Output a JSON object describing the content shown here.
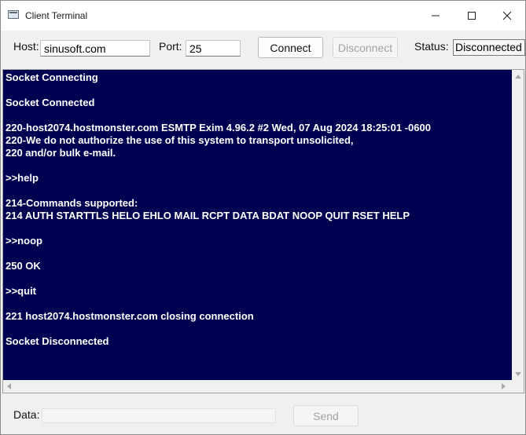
{
  "window": {
    "title": "Client Terminal",
    "icons": {
      "app": "app-window-icon",
      "minimize": "minimize-icon",
      "maximize": "maximize-icon",
      "close": "close-icon"
    }
  },
  "toolbar": {
    "host_label": "Host:",
    "host_value": "sinusoft.com",
    "port_label": "Port:",
    "port_value": "25",
    "connect_label": "Connect",
    "disconnect_label": "Disconnect",
    "status_label": "Status:",
    "status_value": "Disconnected"
  },
  "terminal": {
    "background": "#000050",
    "text_color": "#ffffff",
    "lines": [
      "Socket Connecting",
      "",
      "Socket Connected",
      "",
      "220-host2074.hostmonster.com ESMTP Exim 4.96.2 #2 Wed, 07 Aug 2024 18:25:01 -0600",
      "220-We do not authorize the use of this system to transport unsolicited,",
      "220 and/or bulk e-mail.",
      "",
      ">>help",
      "",
      "214-Commands supported:",
      "214 AUTH STARTTLS HELO EHLO MAIL RCPT DATA BDAT NOOP QUIT RSET HELP",
      "",
      ">>noop",
      "",
      "250 OK",
      "",
      ">>quit",
      "",
      "221 host2074.hostmonster.com closing connection",
      "",
      "Socket Disconnected"
    ]
  },
  "footer": {
    "data_label": "Data:",
    "data_value": "",
    "send_label": "Send"
  }
}
